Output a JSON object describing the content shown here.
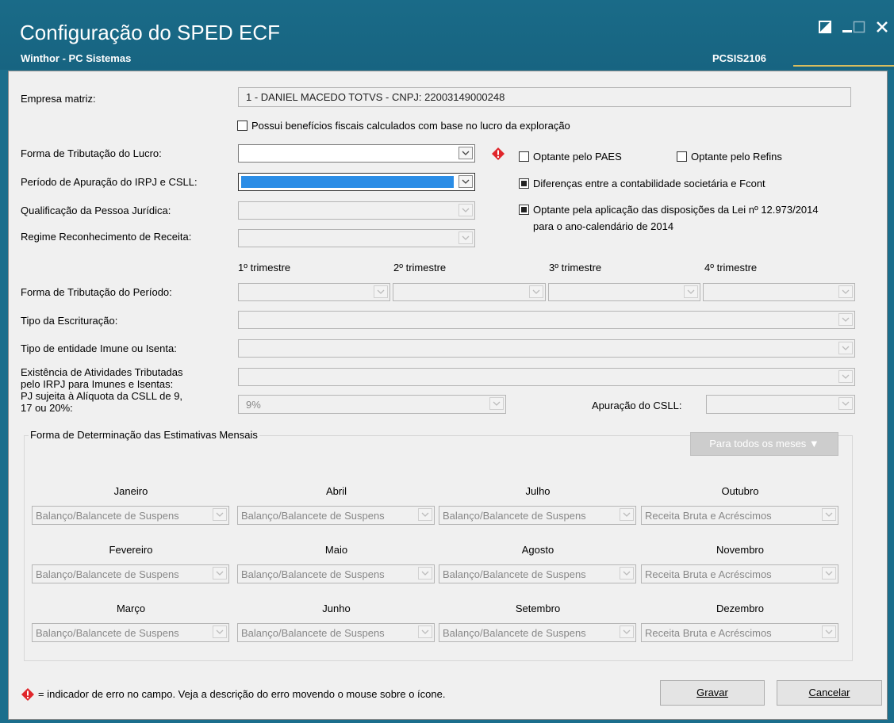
{
  "window": {
    "title": "Configuração do SPED ECF",
    "subtitle": "Winthor - PC Sistemas",
    "code": "PCSIS2106"
  },
  "form": {
    "empresa_label": "Empresa matriz:",
    "empresa_value": "1 - DANIEL MACEDO TOTVS - CNPJ: 22003149000248",
    "beneficios_label": "Possui benefícios fiscais calculados com base no lucro da exploração",
    "forma_trib_label": "Forma de Tributação do Lucro:",
    "periodo_label": "Período de Apuração do IRPJ e CSLL:",
    "qualificacao_label": "Qualificação da Pessoa Jurídica:",
    "regime_label": "Regime Reconhecimento de Receita:",
    "paes_label": "Optante pelo PAES",
    "refins_label": "Optante pelo Refins",
    "diferencas_label": "Diferenças entre a contabilidade societária e Fcont",
    "lei_label_1": "Optante pela aplicação das disposições da Lei  nº 12.973/2014",
    "lei_label_2": "para o ano-calendário de 2014",
    "trimestres": [
      "1º trimestre",
      "2º trimestre",
      "3º trimestre",
      "4º trimestre"
    ],
    "forma_periodo_label": "Forma de Tributação do Período:",
    "tipo_escrit_label": "Tipo da Escrituração:",
    "tipo_entidade_label": "Tipo de entidade Imune ou Isenta:",
    "existencia_label_1": "Existência de Atividades Tributadas",
    "existencia_label_2": "pelo IRPJ para Imunes e Isentas:",
    "pj_label_1": "PJ sujeita à Alíquota da CSLL de 9,",
    "pj_label_2": "17 ou 20%:",
    "pj_value": "9%",
    "apuracao_label": "Apuração do CSLL:"
  },
  "estimativas": {
    "title": "Forma de Determinação das Estimativas Mensais",
    "todos_button": "Para todos os meses ▼",
    "months": [
      {
        "name": "Janeiro",
        "value": "Balanço/Balancete de Suspens"
      },
      {
        "name": "Abril",
        "value": "Balanço/Balancete de Suspens"
      },
      {
        "name": "Julho",
        "value": "Balanço/Balancete de Suspens"
      },
      {
        "name": "Outubro",
        "value": "Receita Bruta e Acréscimos"
      },
      {
        "name": "Fevereiro",
        "value": "Balanço/Balancete de Suspens"
      },
      {
        "name": "Maio",
        "value": "Balanço/Balancete de Suspens"
      },
      {
        "name": "Agosto",
        "value": "Balanço/Balancete de Suspens"
      },
      {
        "name": "Novembro",
        "value": "Receita Bruta e Acréscimos"
      },
      {
        "name": "Março",
        "value": "Balanço/Balancete de Suspens"
      },
      {
        "name": "Junho",
        "value": "Balanço/Balancete de Suspens"
      },
      {
        "name": "Setembro",
        "value": "Balanço/Balancete de Suspens"
      },
      {
        "name": "Dezembro",
        "value": "Receita Bruta e Acréscimos"
      }
    ]
  },
  "footer": {
    "legend": "= indicador de erro no campo. Veja a descrição do erro movendo o mouse sobre o ícone.",
    "gravar": "Gravar",
    "cancelar": "Cancelar"
  },
  "colors": {
    "titlebar": "#1a6b88",
    "accent": "#d8bd5e",
    "error": "#e0262b",
    "selection": "#2b8de6"
  }
}
